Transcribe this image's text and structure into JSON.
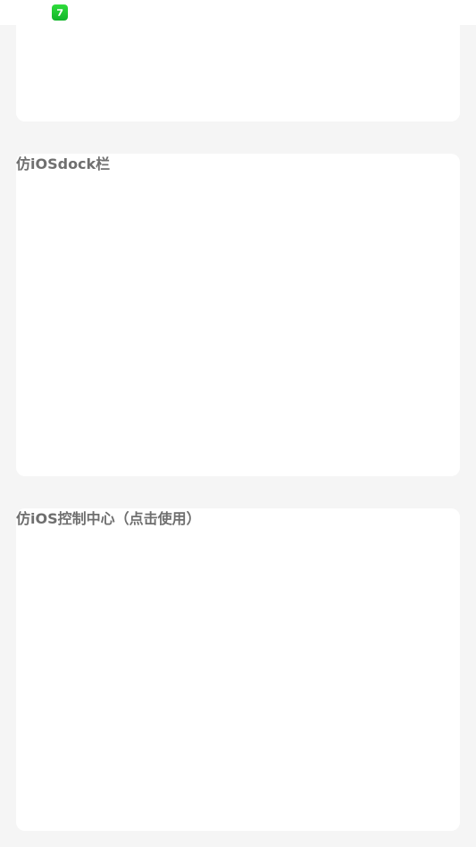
{
  "status_bar": {
    "app_icon": "green-square-7-icon"
  },
  "sections": [
    {
      "title": "仿iOSdock栏"
    },
    {
      "title": "仿iOS控制中心（点击使用）"
    }
  ],
  "colors": {
    "background": "#f5f5f5",
    "card": "#ffffff",
    "title_text": "#6f6f6f",
    "icon_green": "#19c52d"
  }
}
